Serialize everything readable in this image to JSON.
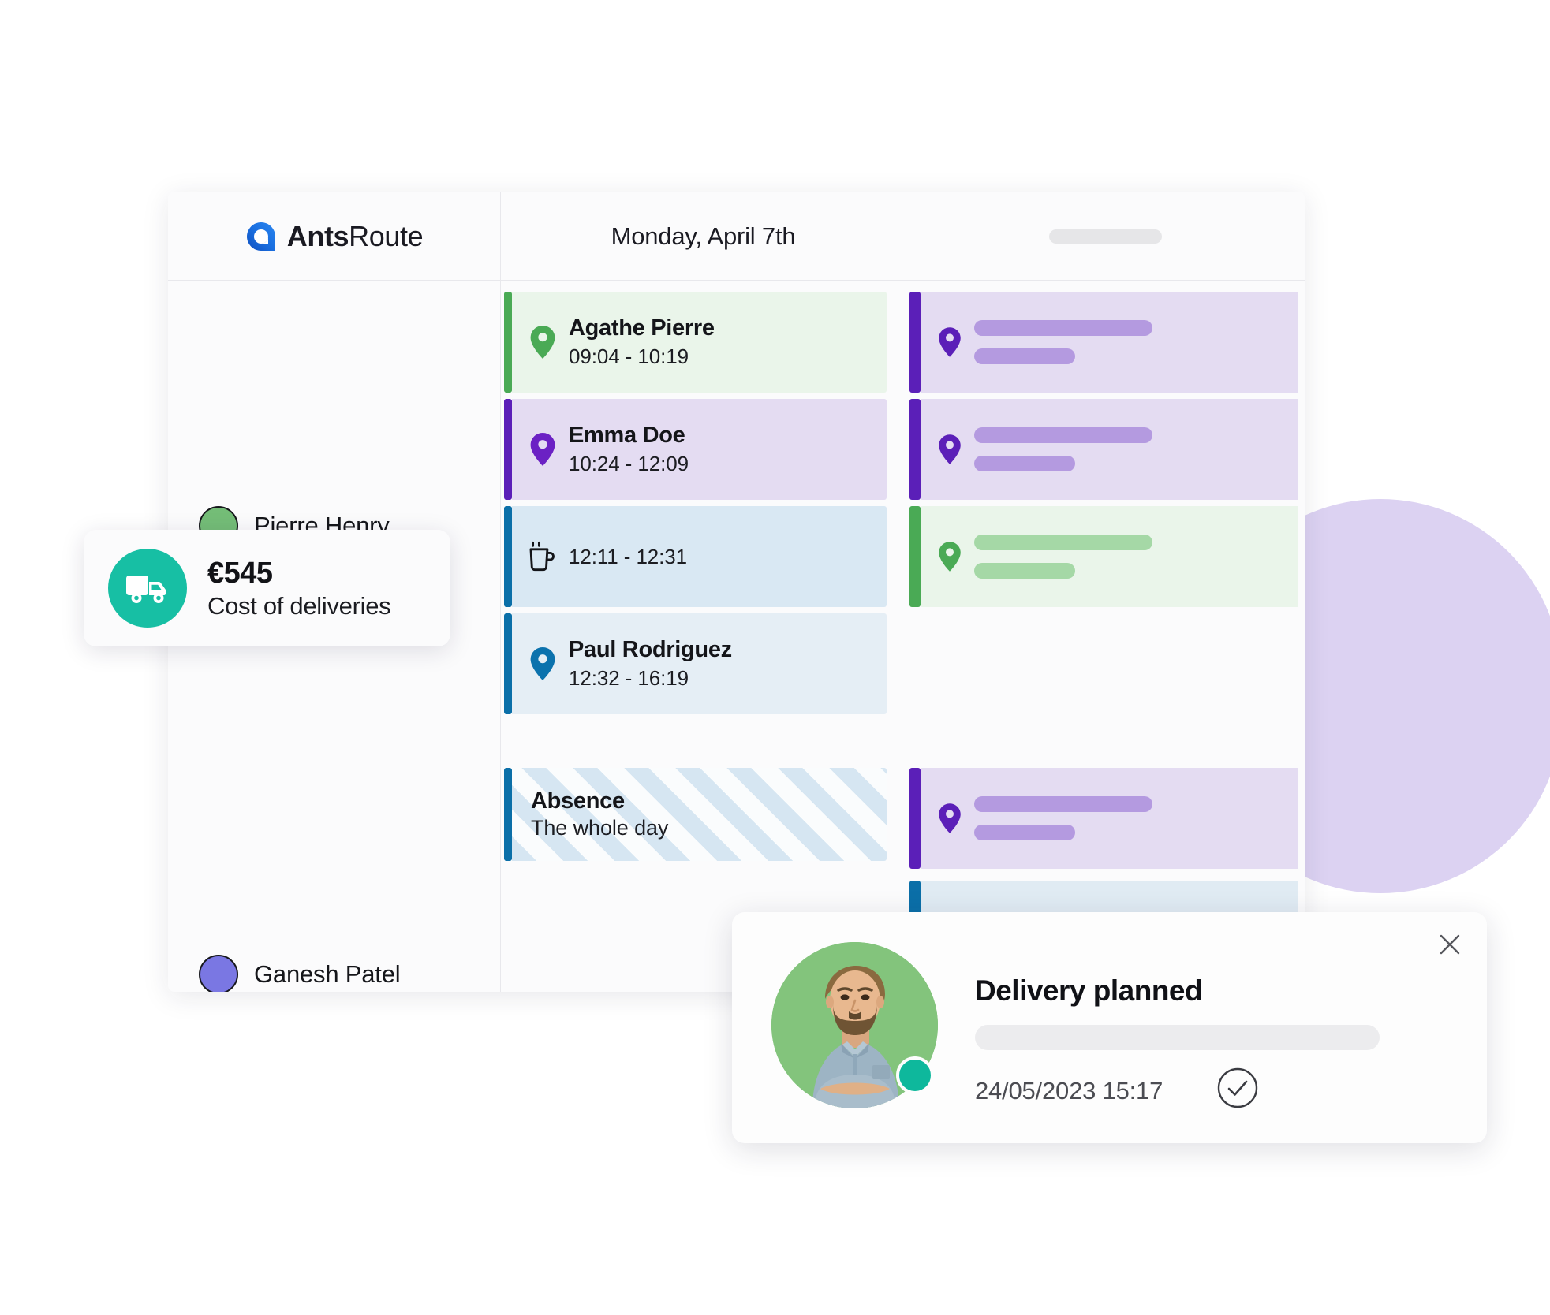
{
  "brand": {
    "name_bold": "Ants",
    "name_light": "Route",
    "logo_icon": "antsroute-logo-icon",
    "logo_color": "#1a6fe0"
  },
  "header": {
    "date": "Monday, April 7th",
    "skeleton_placeholder": ""
  },
  "drivers": [
    {
      "name": "Pierre Henry",
      "color": "#74bd77"
    },
    {
      "name": "Ganesh Patel",
      "color": "#7a77e3"
    }
  ],
  "schedule": [
    {
      "id": "agathe-pierre",
      "title": "Agathe Pierre",
      "time": "09:04 - 10:19",
      "icon": "map-pin-icon",
      "accent": "#4aaa55",
      "background": "#eaf5ea",
      "icon_color": "#4aaa55",
      "type": "visit"
    },
    {
      "id": "emma-doe",
      "title": "Emma Doe",
      "time": "10:24 - 12:09",
      "icon": "map-pin-icon",
      "accent": "#5b1fb8",
      "background": "#e4dcf2",
      "icon_color": "#6b21c4",
      "type": "visit"
    },
    {
      "id": "break",
      "title": "",
      "time": "12:11 - 12:31",
      "icon": "coffee-mug-icon",
      "accent": "#0b6fa8",
      "background": "#d9e8f3",
      "icon_color": "#141519",
      "type": "break"
    },
    {
      "id": "paul-rodriguez",
      "title": "Paul Rodriguez",
      "time": "12:32 - 16:19",
      "icon": "map-pin-icon",
      "accent": "#0b6fa8",
      "background": "#e5eef5",
      "icon_color": "#0b72ad",
      "type": "visit"
    }
  ],
  "absence": {
    "title": "Absence",
    "subtitle": "The whole day",
    "accent": "#0b6fa8"
  },
  "skeleton_cards": [
    {
      "accent": "#5b1fb8",
      "background": "#e4dcf2",
      "line": "#b49ae0",
      "icon": "map-pin-icon",
      "icon_color": "#5b1fb8"
    },
    {
      "accent": "#5b1fb8",
      "background": "#e4dcf2",
      "line": "#b49ae0",
      "icon": "map-pin-icon",
      "icon_color": "#5b1fb8"
    },
    {
      "accent": "#4aaa55",
      "background": "#eaf5ea",
      "line": "#a5d8a6",
      "icon": "map-pin-icon",
      "icon_color": "#4aaa55"
    }
  ],
  "skeleton_cards_lower": [
    {
      "accent": "#5b1fb8",
      "background": "#e4dcf2",
      "line": "#b49ae0",
      "icon": "map-pin-icon",
      "icon_color": "#5b1fb8"
    },
    {
      "accent": "#0b6fa8",
      "background": "#e0ebf3",
      "line": "#9ec3da",
      "icon": "none",
      "icon_color": "#0b6fa8"
    }
  ],
  "cost_card": {
    "amount": "€545",
    "label": "Cost of deliveries",
    "icon": "delivery-truck-icon",
    "icon_bg": "#17bfa4"
  },
  "popup": {
    "title": "Delivery planned",
    "timestamp": "24/05/2023 15:17",
    "close_icon": "close-icon",
    "check_icon": "check-circle-icon",
    "avatar_icon": "driver-avatar",
    "status_color": "#0eb89c",
    "avatar_bg": "#83c47c",
    "skeleton_placeholder": ""
  },
  "decor": {
    "blob_color": "#dcd2f2"
  }
}
